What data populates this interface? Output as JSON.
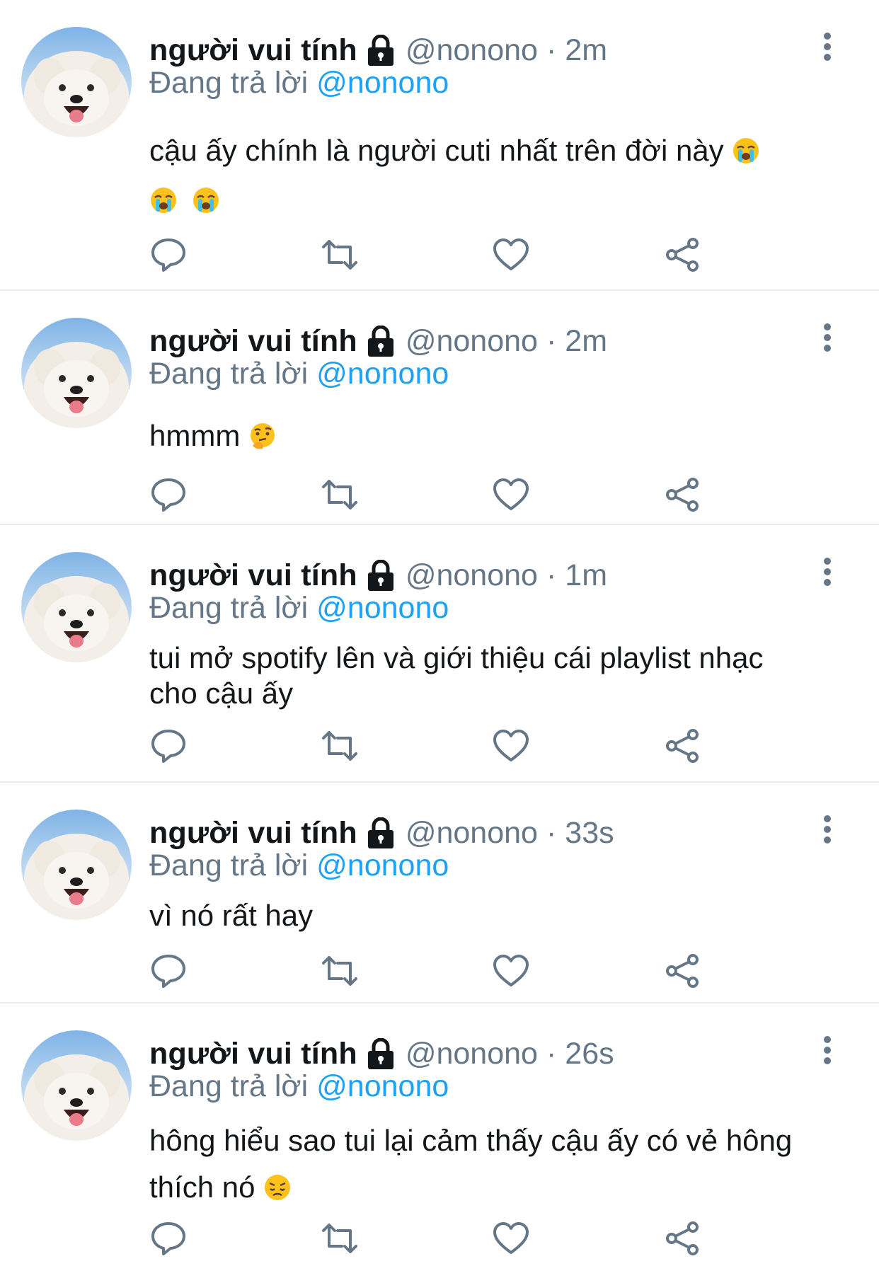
{
  "timeline": {
    "tweets": [
      {
        "display_name": "người vui tính",
        "handle": "@nonono",
        "separator": "·",
        "time": "2m",
        "reply_prefix": "Đang trả lời",
        "reply_to": "@nonono",
        "text_line1": "cậu ấy chính là người cuti nhất trên đời này",
        "emojis": [
          "loudly-crying-face",
          "loudly-crying-face",
          "loudly-crying-face"
        ]
      },
      {
        "display_name": "người vui tính",
        "handle": "@nonono",
        "separator": "·",
        "time": "2m",
        "reply_prefix": "Đang trả lời",
        "reply_to": "@nonono",
        "text_line1": "hmmm",
        "emojis": [
          "thinking-face"
        ]
      },
      {
        "display_name": "người vui tính",
        "handle": "@nonono",
        "separator": "·",
        "time": "1m",
        "reply_prefix": "Đang trả lời",
        "reply_to": "@nonono",
        "text_line1": "tui mở spotify lên và giới thiệu cái playlist nhạc",
        "text_line2": "cho cậu ấy",
        "emojis": []
      },
      {
        "display_name": "người vui tính",
        "handle": "@nonono",
        "separator": "·",
        "time": "33s",
        "reply_prefix": "Đang trả lời",
        "reply_to": "@nonono",
        "text_line1": "vì nó rất hay",
        "emojis": []
      },
      {
        "display_name": "người vui tính",
        "handle": "@nonono",
        "separator": "·",
        "time": "26s",
        "reply_prefix": "Đang trả lời",
        "reply_to": "@nonono",
        "text_line1": "hông hiểu sao tui lại cảm thấy cậu ấy có vẻ hông",
        "text_line2": "thích nó",
        "emojis": [
          "disappointed-face"
        ]
      }
    ]
  },
  "icons": {
    "protected": "lock-icon",
    "more": "more-vertical-icon",
    "actions": [
      "reply-icon",
      "retweet-icon",
      "like-icon",
      "share-icon"
    ]
  },
  "colors": {
    "text": "#14171a",
    "secondary": "#657786",
    "link": "#1da1f2",
    "divider": "#e6ecf0",
    "icon": "#657786"
  }
}
